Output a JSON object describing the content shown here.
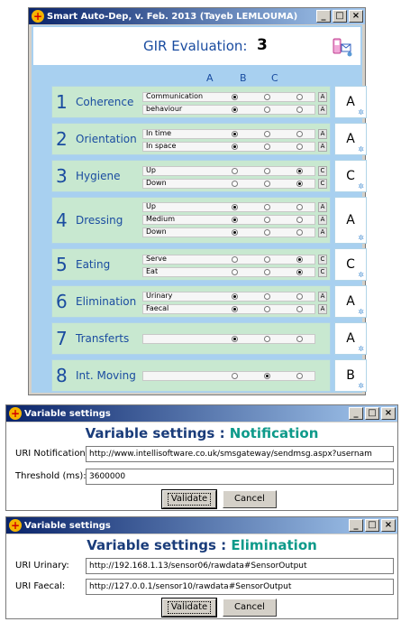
{
  "main_window": {
    "title": "Smart Auto-Dep, v. Feb. 2013 (Tayeb LEMLOUMA)",
    "gir_label": "GIR Evaluation:",
    "gir_score": "3",
    "columns": [
      "A",
      "B",
      "C"
    ],
    "criteria": [
      {
        "number": "1",
        "name": "Coherence",
        "result": "A",
        "items": [
          {
            "label": "Communication",
            "selected": "A",
            "letter": "A"
          },
          {
            "label": "behaviour",
            "selected": "A",
            "letter": "A"
          }
        ]
      },
      {
        "number": "2",
        "name": "Orientation",
        "result": "A",
        "items": [
          {
            "label": "In time",
            "selected": "A",
            "letter": "A"
          },
          {
            "label": "In space",
            "selected": "A",
            "letter": "A"
          }
        ]
      },
      {
        "number": "3",
        "name": "Hygiene",
        "result": "C",
        "items": [
          {
            "label": "Up",
            "selected": "C",
            "letter": "C"
          },
          {
            "label": "Down",
            "selected": "C",
            "letter": "C"
          }
        ]
      },
      {
        "number": "4",
        "name": "Dressing",
        "result": "A",
        "items": [
          {
            "label": "Up",
            "selected": "A",
            "letter": "A"
          },
          {
            "label": "Medium",
            "selected": "A",
            "letter": "A"
          },
          {
            "label": "Down",
            "selected": "A",
            "letter": "A"
          }
        ]
      },
      {
        "number": "5",
        "name": "Eating",
        "result": "C",
        "items": [
          {
            "label": "Serve",
            "selected": "C",
            "letter": "C"
          },
          {
            "label": "Eat",
            "selected": "C",
            "letter": "C"
          }
        ]
      },
      {
        "number": "6",
        "name": "Elimination",
        "result": "A",
        "items": [
          {
            "label": "Urinary",
            "selected": "A",
            "letter": "A"
          },
          {
            "label": "Faecal",
            "selected": "A",
            "letter": "A"
          }
        ]
      },
      {
        "number": "7",
        "name": "Transferts",
        "result": "A",
        "items": [
          {
            "label": "",
            "selected": "A",
            "letter": ""
          }
        ]
      },
      {
        "number": "8",
        "name": "Int. Moving",
        "result": "B",
        "items": [
          {
            "label": "",
            "selected": "B",
            "letter": ""
          }
        ]
      }
    ]
  },
  "dialog_notification": {
    "title": "Variable settings",
    "heading": "Variable settings : ",
    "heading_accent": "Notification",
    "fields": [
      {
        "label": "URI Notification:",
        "value": "http://www.intellisoftware.co.uk/smsgateway/sendmsg.aspx?usernam"
      },
      {
        "label": "Threshold (ms):",
        "value": "3600000"
      }
    ],
    "validate": "Validate",
    "cancel": "Cancel"
  },
  "dialog_elimination": {
    "title": "Variable settings",
    "heading": "Variable settings : ",
    "heading_accent": "Elimination",
    "fields": [
      {
        "label": "URI Urinary:",
        "value": "http://192.168.1.13/sensor06/rawdata#SensorOutput"
      },
      {
        "label": "URI Faecal:",
        "value": "http://127.0.0.1/sensor10/rawdata#SensorOutput"
      }
    ],
    "validate": "Validate",
    "cancel": "Cancel"
  }
}
